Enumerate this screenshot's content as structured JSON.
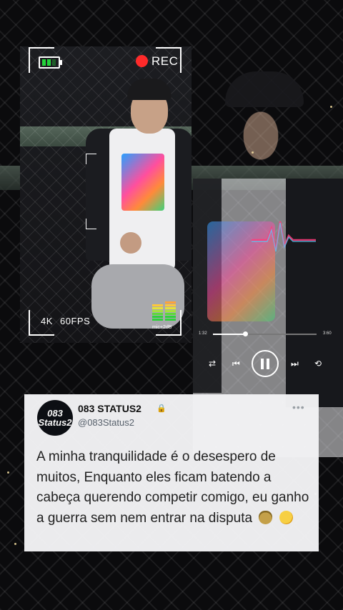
{
  "camera": {
    "rec_label": "REC",
    "resolution": "4K",
    "fps": "60FPS",
    "mic_label": "mic+2dB",
    "battery_level": 0.66
  },
  "player": {
    "elapsed": "1:32",
    "duration": "3:60",
    "progress": 0.31
  },
  "tweet": {
    "name": "083 STATUS2",
    "handle": "@083Status2",
    "avatar_text": "083 Status2",
    "more_label": "•••",
    "text": "A minha tranquilidade é o desespero de muitos, Enquanto eles ficam batendo a cabeça querendo competir comigo, eu ganho a guerra sem nem entrar na disputa",
    "emojis": [
      "money-bag-emoji",
      "partying-face-emoji"
    ]
  },
  "colors": {
    "rec": "#ff2a2a",
    "battery": "#23d33a",
    "card_bg": "#f3f3f5"
  }
}
